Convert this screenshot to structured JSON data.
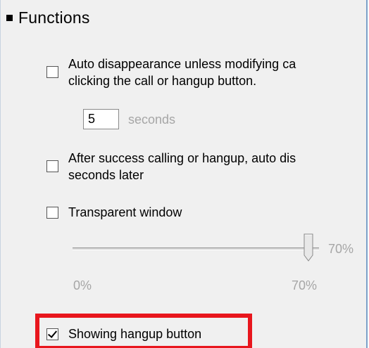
{
  "section": {
    "title": "Functions"
  },
  "options": {
    "auto_disappear": {
      "checked": false,
      "line1": "Auto disappearance unless modifying ca",
      "line2": "clicking the call or hangup button."
    },
    "delay": {
      "value": "5",
      "unit": "seconds"
    },
    "after_success": {
      "checked": false,
      "line1": "After success calling or hangup, auto dis",
      "line2": "seconds later"
    },
    "transparent": {
      "checked": false,
      "label": "Transparent window"
    },
    "transparency_slider": {
      "value_percent": 70,
      "value_label": "70%",
      "min_label": "0%",
      "max_label": "70%"
    },
    "show_hangup": {
      "checked": true,
      "label": "Showing hangup button"
    }
  },
  "colors": {
    "highlight": "#e8161d",
    "panel_bg": "#f0f0f0",
    "muted_text": "#a6a6a6"
  }
}
